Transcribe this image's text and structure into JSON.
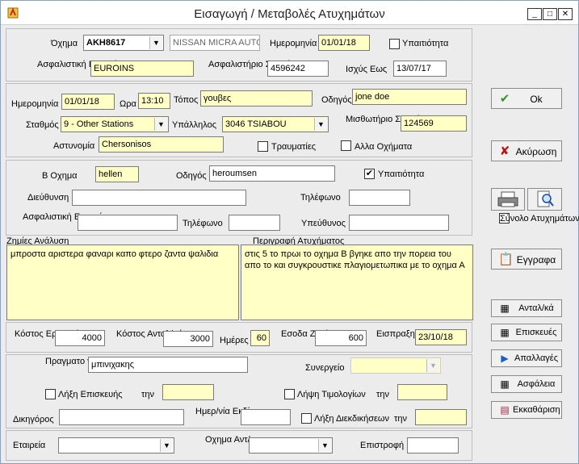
{
  "window": {
    "title": "Εισαγωγή / Μεταβολές  Ατυχημάτων",
    "minimize": "_",
    "maximize": "□",
    "close": "✕"
  },
  "vehicle": {
    "label": "Όχημα",
    "plate": "AKH8617",
    "model": "NISSAN MICRA AUTO",
    "date_label": "Ημερομηνία",
    "date": "01/01/18",
    "suspect_label": "Υπαιτιότητα",
    "insurer_label": "Ασφαλιστική Εταιρεία",
    "insurer": "EUROINS",
    "policy_label": "Ασφαλιστήριο Συμβόλαιο",
    "policy": "4596242",
    "valid_label": "Ισχύς Εως",
    "valid": "13/07/17"
  },
  "accident": {
    "date_label": "Ημερομηνία",
    "date": "01/01/18",
    "time_label": "Ωρα",
    "time": "13:10",
    "place_label": "Τόπος",
    "place": "γουβες",
    "driver_label": "Οδηγός",
    "driver": "jone doe",
    "station_label": "Σταθμός",
    "station": "9 - Other Stations",
    "employee_label": "Υπάλληλος",
    "employee": "3046 TSIABOU",
    "rental_label": "Μισθωτήριο Συμβόλαιο",
    "rental": "124569",
    "police_label": "Αστυνομία",
    "police": "Chersonisos",
    "injuries_label": "Τραυματίες",
    "other_vehicles_label": "Αλλα Οχήματα"
  },
  "b_vehicle": {
    "label": "Β Οχημα",
    "value": "hellen",
    "driver_label": "Οδηγός",
    "driver": "heroumsen",
    "suspect_label": "Υπαιτιότητα",
    "suspect_check": "✔",
    "address_label": "Διεύθυνση",
    "phone_label": "Τηλέφωνο",
    "insurer_label": "Ασφαλιστική Εταιρεία",
    "phone2_label": "Τηλέφωνο",
    "responsible_label": "Υπεύθυνος"
  },
  "damages": {
    "label": "Ζημίες Ανάλυση",
    "text": "μπροστα αριστερα φαναρι καπο φτερο ζαντα ψαλιδια"
  },
  "description": {
    "label": "Περιγραφή Ατυχήματος",
    "text": "στις 5 το πρωι το οχημα Β βγηκε απο την πορεια του απο το   και συγκρουστικε πλαγιομετωπικα με το οχημα Α"
  },
  "costs": {
    "labor_label": "Κόστος Εργασιών",
    "labor": "4000",
    "parts_label": "Κόστος Ανταλ/κών",
    "parts": "3000",
    "days_label": "Ημέρες",
    "days": "60",
    "income_label": "Εσοδα Ζημίας",
    "income": "600",
    "collected_label": "Εισπραξη την",
    "collected": "23/10/18"
  },
  "assessor": {
    "label": "Πραγματο γνώμονας",
    "value": "μπινιχακης",
    "garage_label": "Συνεργείο",
    "repair_end_label": "Λήξη Επισκευής",
    "on_label1": "την",
    "invoice_label": "Λήψη Τιμολογίων",
    "on_label2": "την",
    "lawyer_label": "Δικηγόρος",
    "trial_label": "Ημερ/νία Εκδίκασης",
    "claims_end_label": "Λήξη Διεκδικήσεων",
    "on_label3": "την"
  },
  "footer": {
    "company_label": "Εταιρεία",
    "counter_label": "Οχημα Αντ/σης",
    "return_label": "Επιστροφή"
  },
  "buttons": {
    "ok": "Ok",
    "cancel": "Ακύρωση",
    "total_label": "Σύνολο Ατυχημάτων",
    "docs": "Εγγραφα",
    "parts": "Ανταλ/κά",
    "repairs": "Επισκευές",
    "exemptions": "Απαλλαγές",
    "insurance": "Ασφάλεια",
    "clearance": "Εκκαθάριση"
  }
}
